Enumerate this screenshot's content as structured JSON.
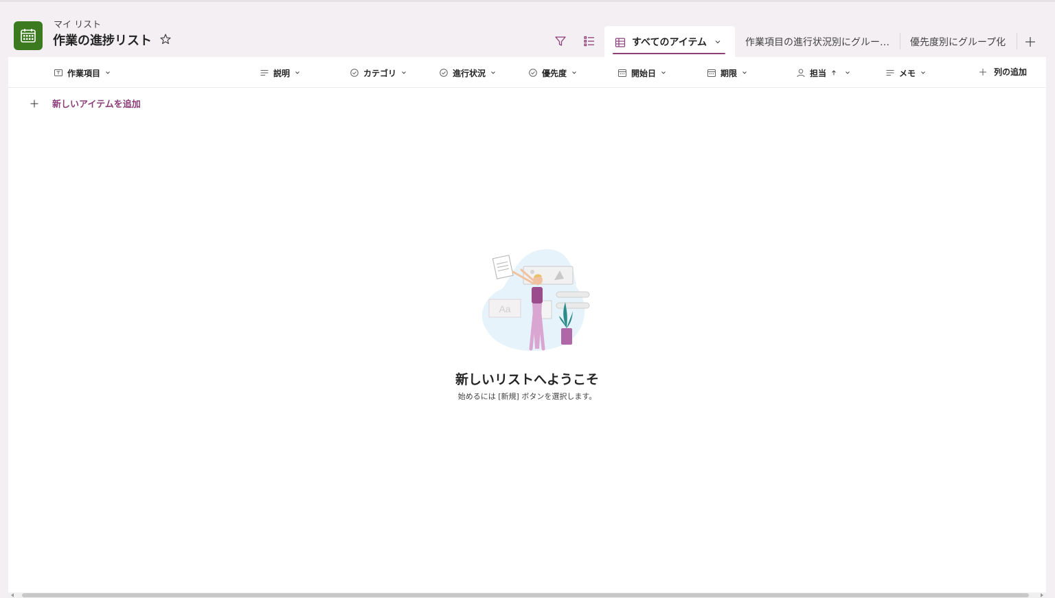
{
  "header": {
    "breadcrumb": "マイ リスト",
    "title": "作業の進捗リスト"
  },
  "views": {
    "active": "すべてのアイテム",
    "tabs": [
      "作業項目の進行状況別にグルー…",
      "優先度別にグループ化"
    ]
  },
  "columns": [
    {
      "label": "作業項目",
      "icon": "title-icon"
    },
    {
      "label": "説明",
      "icon": "text-lines-icon"
    },
    {
      "label": "カテゴリ",
      "icon": "choice-icon"
    },
    {
      "label": "進行状況",
      "icon": "choice-icon"
    },
    {
      "label": "優先度",
      "icon": "choice-icon"
    },
    {
      "label": "開始日",
      "icon": "calendar-icon"
    },
    {
      "label": "期限",
      "icon": "calendar-icon"
    },
    {
      "label": "担当",
      "icon": "person-icon",
      "sort": "ascending"
    },
    {
      "label": "メモ",
      "icon": "text-lines-icon"
    }
  ],
  "add_column_label": "列の追加",
  "add_item_label": "新しいアイテムを追加",
  "empty_state": {
    "title": "新しいリストへようこそ",
    "subtitle": "始めるには [新規] ボタンを選択します。"
  },
  "colors": {
    "accent": "#8b3e78",
    "list_icon": "#3b7a1f",
    "background": "#f3eff2"
  }
}
